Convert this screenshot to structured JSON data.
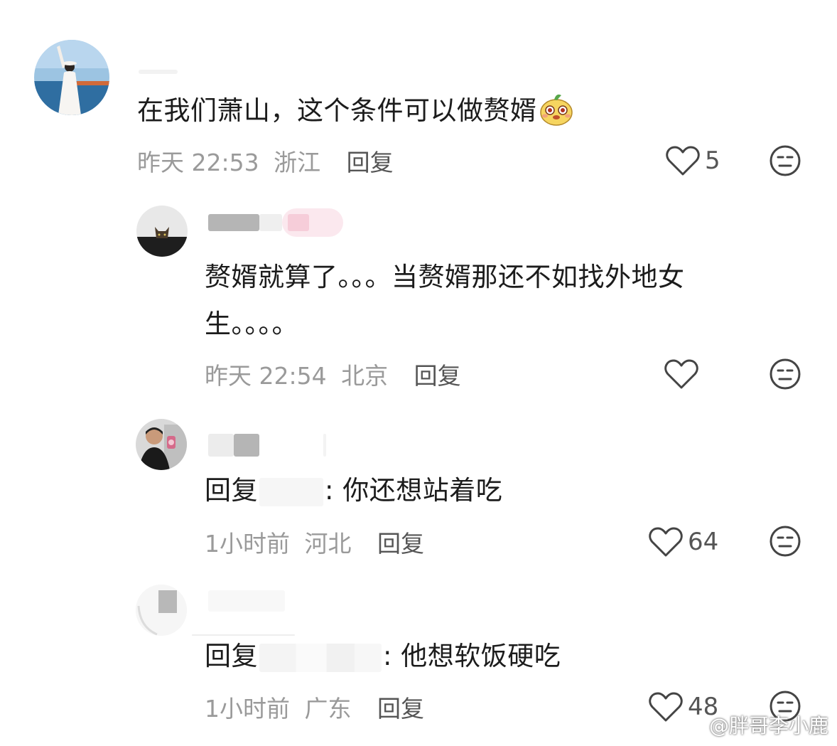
{
  "comments": [
    {
      "text": "在我们萧山，这个条件可以做赘婿",
      "time": "昨天 22:53",
      "location": "浙江",
      "reply_label": "回复",
      "likes": "5"
    },
    {
      "text_line1": "赘婿就算了。。。当赘婿那还不如找外地女",
      "text_line2": "生。。。。",
      "time": "昨天 22:54",
      "location": "北京",
      "reply_label": "回复",
      "likes": ""
    },
    {
      "reply_prefix": "回复",
      "text": ": 你还想站着吃",
      "time": "1小时前",
      "location": "河北",
      "reply_label": "回复",
      "likes": "64"
    },
    {
      "reply_prefix": "回复",
      "text": ": 他想软饭硬吃",
      "time": "1小时前",
      "location": "广东",
      "reply_label": "回复",
      "likes": "48"
    }
  ],
  "watermark": {
    "text": "@胖哥李小鹿"
  },
  "icons": {
    "like": "heart-outline-icon",
    "dislike": "meh-face-icon",
    "emoji": "smiling-cartoon-emoji-icon",
    "watermark": "weibo-logo-icon"
  },
  "colors": {
    "text": "#1c1c1c",
    "meta": "#9a9a9a",
    "reply": "#555555"
  }
}
